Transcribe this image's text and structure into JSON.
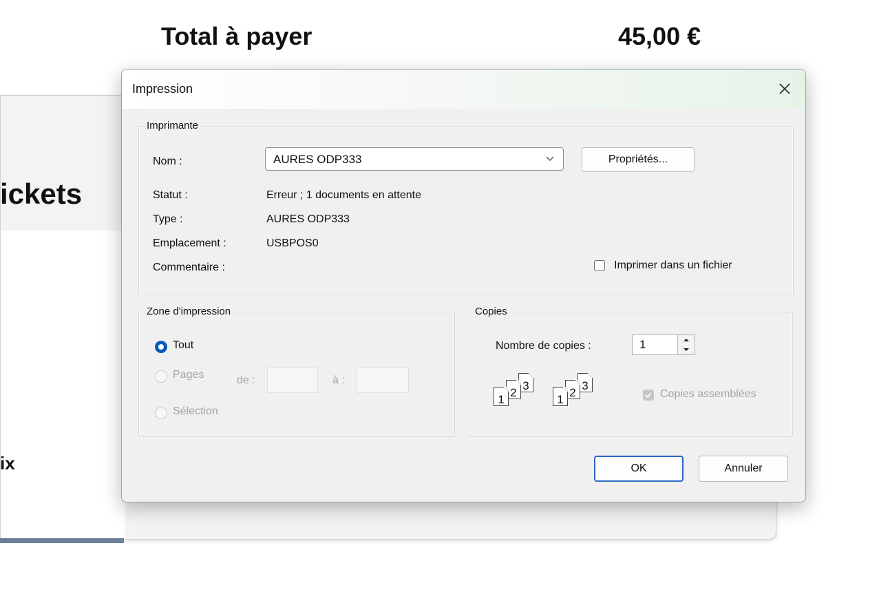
{
  "background": {
    "total_label": "Total à payer",
    "total_value": "45,00 €",
    "partial_heading": "ickets",
    "partial_text": "ix"
  },
  "dialog": {
    "title": "Impression",
    "printer": {
      "legend": "Imprimante",
      "name_label": "Nom :",
      "name_value": "AURES ODP333",
      "properties_button": "Propriétés...",
      "status_label": "Statut :",
      "status_value": "Erreur ; 1 documents en attente",
      "type_label": "Type :",
      "type_value": "AURES ODP333",
      "location_label": "Emplacement :",
      "location_value": "USBPOS0",
      "comment_label": "Commentaire :",
      "print_to_file_label": "Imprimer dans un fichier",
      "print_to_file_checked": false
    },
    "print_range": {
      "legend": "Zone d'impression",
      "all_label": "Tout",
      "pages_label": "Pages",
      "from_label": "de :",
      "to_label": "à :",
      "from_value": "",
      "to_value": "",
      "selection_label": "Sélection",
      "selected": "Tout"
    },
    "copies": {
      "legend": "Copies",
      "count_label": "Nombre de copies :",
      "count_value": "1",
      "collate_label": "Copies assemblées",
      "collate_checked": true,
      "collate_icon_set1": [
        "1",
        "2",
        "3"
      ],
      "collate_icon_set2": [
        "1",
        "2",
        "3"
      ]
    },
    "ok_button": "OK",
    "cancel_button": "Annuler"
  },
  "colors": {
    "accent": "#0a58b8",
    "primary_button_border": "#2b67c6",
    "dialog_background": "#f0f0f0"
  },
  "icons": [
    "close-icon",
    "chevron-down-icon",
    "spin-up-icon",
    "spin-down-icon",
    "collate-pages-icon",
    "checkmark-icon"
  ]
}
